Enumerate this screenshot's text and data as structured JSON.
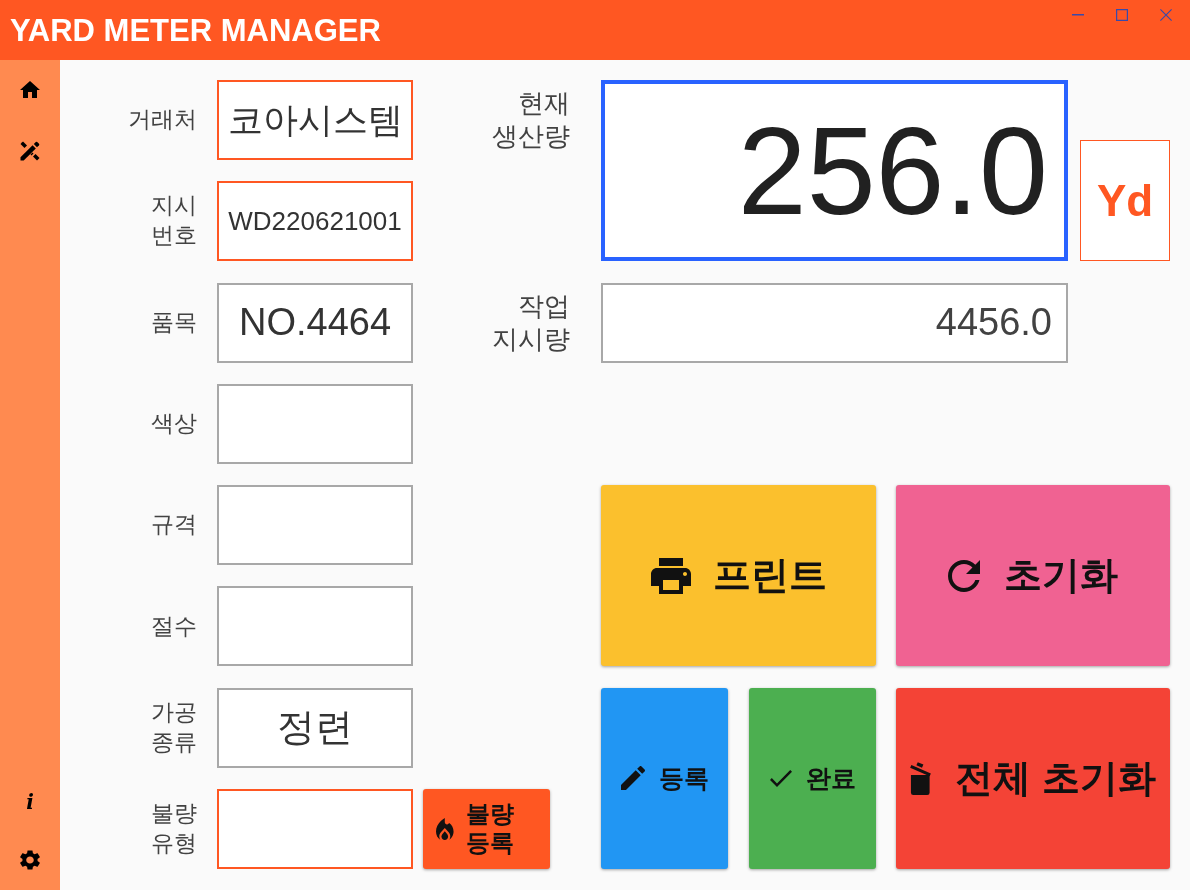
{
  "window": {
    "title": "YARD METER MANAGER"
  },
  "sidebar": {
    "info_glyph": "i"
  },
  "form": {
    "fields": [
      {
        "label": "거래처",
        "value": "코아시스템",
        "highlighted": true
      },
      {
        "label": "지시 번호",
        "value": "WD220621001",
        "highlighted": true
      },
      {
        "label": "품목",
        "value": "NO.4464",
        "highlighted": false
      },
      {
        "label": "색상",
        "highlighted": false
      },
      {
        "label": "규격",
        "highlighted": false
      },
      {
        "label": "절수",
        "highlighted": false
      },
      {
        "label": "가공 종류",
        "value": "정련",
        "highlighted": false
      },
      {
        "label": "불량 유형",
        "highlighted": true
      }
    ],
    "defect_button": {
      "label": "불량 등록"
    }
  },
  "current_output": {
    "label": "현재 생산량",
    "value": "256.0",
    "unit": "Yd"
  },
  "order_quantity": {
    "label": "작업 지시량",
    "value": "4456.0"
  },
  "actions": [
    {
      "kind": "print",
      "label": "프린트",
      "color": "#fbc02d"
    },
    {
      "kind": "reset",
      "label": "초기화",
      "color": "#f06292"
    },
    {
      "kind": "register",
      "label": "등록",
      "color": "#2196f3"
    },
    {
      "kind": "complete",
      "label": "완료",
      "color": "#4caf50"
    },
    {
      "kind": "reset_all",
      "label": "전체 초기화",
      "color": "#f44336"
    }
  ]
}
